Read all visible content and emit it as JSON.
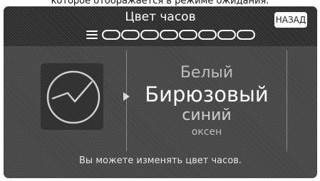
{
  "caption": "которое отображается в режиме ожидания.",
  "screen": {
    "title": "Цвет часов",
    "back_label": "НАЗАД",
    "progress": {
      "total": 8,
      "filled": 0
    }
  },
  "picker": {
    "options": [
      "Белый",
      "Бирюзовый",
      "синий",
      "оксен"
    ],
    "selected_index": 1
  },
  "hint": "Вы можете изменять цвет часов.",
  "colors": {
    "screen_bg": "#454545",
    "header_bg": "#2c2c2c",
    "text": "#ffffff",
    "dim_text": "#bdbdbd"
  }
}
